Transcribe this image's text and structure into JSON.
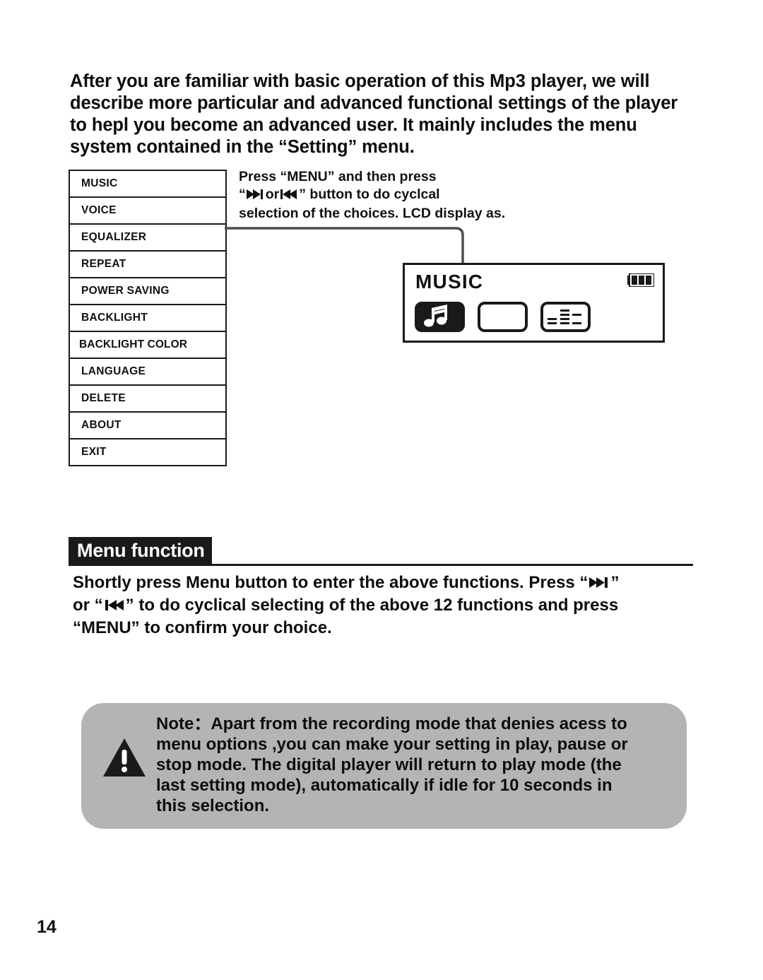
{
  "intro": {
    "lines": [
      "After you are familiar with basic operation of this Mp3 player, we will",
      "describe more particular and advanced functional settings of the player",
      "to hepl you become an advanced user. It mainly includes the menu",
      "system contained in the “Setting” menu."
    ]
  },
  "menu_table": {
    "items": [
      {
        "label": "MUSIC"
      },
      {
        "label": "VOICE"
      },
      {
        "label": "EQUALIZER"
      },
      {
        "label": "REPEAT"
      },
      {
        "label": "POWER SAVING"
      },
      {
        "label": "BACKLIGHT"
      },
      {
        "label": "BACKLIGHT COLOR"
      },
      {
        "label": "LANGUAGE"
      },
      {
        "label": "DELETE"
      },
      {
        "label": "ABOUT"
      },
      {
        "label": "EXIT"
      }
    ]
  },
  "instruction": {
    "line1": "Press “MENU” and then press",
    "line2_pre": "“",
    "line2_mid": "or",
    "line2_post": "” button to do cyclcal",
    "line3": "selection of the choices. LCD display as.",
    "forward_icon": "fast-forward-icon",
    "rewind_icon": "rewind-icon"
  },
  "lcd": {
    "title": "MUSIC",
    "battery_icon": "battery-icon",
    "battery_segments": 3,
    "icons": [
      {
        "name": "music-note-icon",
        "state": "selected"
      },
      {
        "name": "blank-mode-icon",
        "state": "unselected"
      },
      {
        "name": "equalizer-icon",
        "state": "unselected"
      }
    ]
  },
  "section": {
    "heading": "Menu function",
    "body_lines": [
      "Shortly press Menu button to enter the above functions. Press “",
      "”",
      "or “",
      "”  to do cyclical selecting of the above 12 functions and press",
      "“MENU”  to confirm your choice."
    ],
    "body_line1_pre": "Shortly press Menu button to enter the above functions. Press  “",
    "body_line1_post": "”",
    "body_line2_pre": "or “",
    "body_line2_post": "”  to do cyclical selecting of the above 12 functions and press",
    "body_line3": "“MENU”  to confirm your choice."
  },
  "note": {
    "icon": "warning-triangle-icon",
    "lines": [
      "Note：Apart from the recording mode that denies acess to",
      "menu options ,you can make your setting in play, pause or",
      "stop mode. The digital player will return to play mode (the",
      "last setting mode), automatically if idle for 10 seconds in",
      "this selection."
    ]
  },
  "footer": {
    "page_number": "14"
  },
  "colors": {
    "ink": "#111111",
    "note_background": "#b4b4b4",
    "heading_background": "#1a1a1a",
    "paper": "#ffffff"
  }
}
